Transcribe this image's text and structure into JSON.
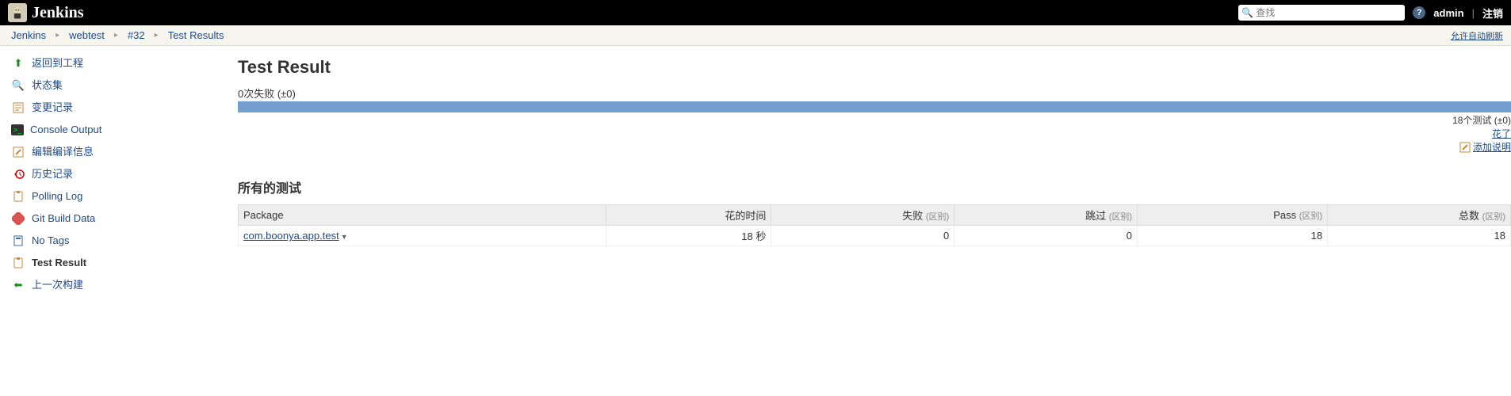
{
  "header": {
    "brand": "Jenkins",
    "search_placeholder": "查找",
    "user": "admin",
    "logout": "注销"
  },
  "breadcrumb": {
    "items": [
      "Jenkins",
      "webtest",
      "#32",
      "Test Results"
    ],
    "auto_refresh": "允许自动刷新"
  },
  "sidebar": {
    "items": [
      {
        "label": "返回到工程"
      },
      {
        "label": "状态集"
      },
      {
        "label": "变更记录"
      },
      {
        "label": "Console Output"
      },
      {
        "label": "编辑编译信息"
      },
      {
        "label": "历史记录"
      },
      {
        "label": "Polling Log"
      },
      {
        "label": "Git Build Data"
      },
      {
        "label": "No Tags"
      },
      {
        "label": "Test Result"
      },
      {
        "label": "上一次构建"
      }
    ]
  },
  "main": {
    "title": "Test Result",
    "fail_summary": "0次失败 (±0)",
    "tests_count": "18个测试 (±0)",
    "took": "花了",
    "add_description": "添加说明",
    "all_tests": "所有的测试",
    "cols": {
      "package": "Package",
      "duration": "花的时间",
      "fail": "失败",
      "skip": "跳过",
      "pass": "Pass",
      "total": "总数",
      "diff": "(区别)"
    },
    "rows": [
      {
        "package": "com.boonya.app.test",
        "duration": "18 秒",
        "fail": "0",
        "skip": "0",
        "pass": "18",
        "total": "18"
      }
    ]
  }
}
